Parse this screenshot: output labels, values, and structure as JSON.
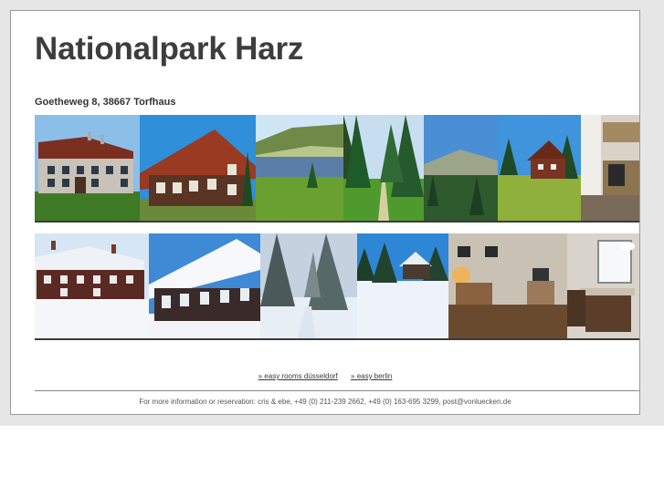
{
  "page": {
    "title": "Nationalpark Harz",
    "address": "Goetheweg 8, 38667 Torfhaus"
  },
  "gallery": {
    "row1": [
      {
        "name": "photo-house-summer-front"
      },
      {
        "name": "photo-house-summer-side"
      },
      {
        "name": "photo-lake-meadow"
      },
      {
        "name": "photo-forest-path"
      },
      {
        "name": "photo-mountain-view"
      },
      {
        "name": "photo-house-meadow"
      },
      {
        "name": "photo-kitchen"
      }
    ],
    "row2": [
      {
        "name": "photo-house-winter-front"
      },
      {
        "name": "photo-house-winter-side"
      },
      {
        "name": "photo-snowy-forest"
      },
      {
        "name": "photo-house-winter-distant"
      },
      {
        "name": "photo-living-room"
      },
      {
        "name": "photo-dining-room"
      }
    ]
  },
  "links": {
    "dusseldorf": "» easy rooms düsseldorf",
    "berlin": "» easy berlin"
  },
  "footer": {
    "text": "For more information or reservation: cris & ebe, +49 (0) 211-239 2662, +49 (0) 163-695 3299, post@vonluecken.de"
  }
}
